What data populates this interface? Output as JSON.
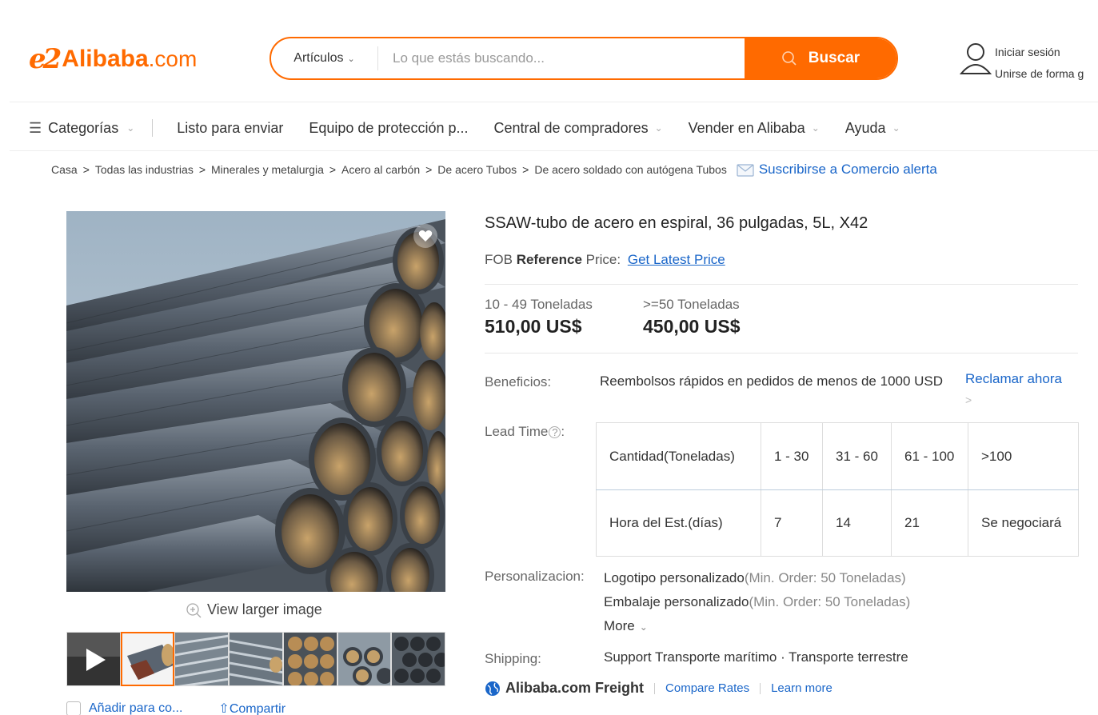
{
  "header": {
    "logo_brand": "Alibaba",
    "logo_tld": ".com",
    "search_category": "Artículos",
    "search_placeholder": "Lo que estás buscando...",
    "search_button": "Buscar",
    "sign_in": "Iniciar sesión",
    "join": "Unirse de forma g"
  },
  "nav": {
    "categories": "Categorías",
    "items": [
      "Listo para enviar",
      "Equipo de protección p...",
      "Central de compradores",
      "Vender en Alibaba",
      "Ayuda"
    ]
  },
  "breadcrumb": {
    "items": [
      "Casa",
      "Todas las industrias",
      "Minerales y metalurgia",
      "Acero al carbón",
      "De acero Tubos",
      "De acero soldado con autógena Tubos"
    ],
    "separator": ">",
    "alert": "Suscribirse a Comercio alerta"
  },
  "gallery": {
    "view_larger": "View larger image",
    "add_to_compare": "Añadir para co...",
    "share": "Compartir"
  },
  "product": {
    "title": "SSAW-tubo de acero en espiral, 36 pulgadas, 5L, X42",
    "fob_prefix": "FOB",
    "fob_bold": "Reference",
    "fob_suffix": "Price:",
    "fob_link": "Get Latest Price",
    "prices": [
      {
        "qty": "10 - 49 Toneladas",
        "price": "510,00 US$"
      },
      {
        "qty": ">=50 Toneladas",
        "price": "450,00 US$"
      }
    ],
    "benefits_label": "Beneficios:",
    "benefits_text": "Reembolsos rápidos en pedidos de menos de 1000 USD",
    "claim": "Reclamar ahora",
    "claim_arrow": ">",
    "lead_time_label": "Lead Time",
    "lead_time": {
      "row1": [
        "Cantidad(Toneladas)",
        "1 - 30",
        "31 - 60",
        "61 - 100",
        ">100"
      ],
      "row2": [
        "Hora del Est.(días)",
        "7",
        "14",
        "21",
        "Se negociará"
      ]
    },
    "custom_label": "Personalizacion:",
    "custom": [
      {
        "name": "Logotipo personalizado",
        "note": "(Min. Order: 50 Toneladas)"
      },
      {
        "name": "Embalaje personalizado",
        "note": "(Min. Order: 50 Toneladas)"
      }
    ],
    "more": "More",
    "shipping_label": "Shipping:",
    "shipping_text": "Support Transporte marítimo · Transporte terrestre",
    "freight_brand": "Alibaba.com Freight",
    "compare_rates": "Compare Rates",
    "learn_more": "Learn more"
  },
  "colors": {
    "accent": "#ff6a00",
    "link": "#1a66c9"
  }
}
